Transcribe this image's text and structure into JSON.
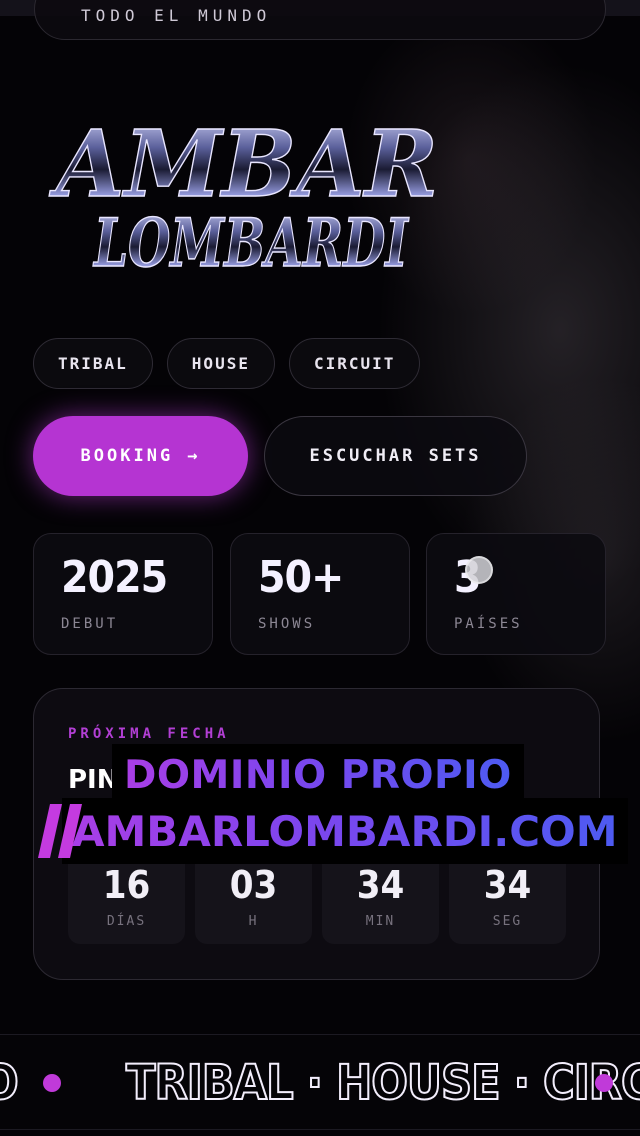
{
  "colors": {
    "accent": "#b534d2",
    "background": "#040306",
    "overlay_gradient_start": "#a93ee6",
    "overlay_gradient_end": "#4d5bf2"
  },
  "top_bar": {
    "text": "TODO EL MUNDO"
  },
  "logo": {
    "line1": "AMBAR",
    "line2": "LOMBARDI"
  },
  "genre_tags": [
    "TRIBAL",
    "HOUSE",
    "CIRCUIT"
  ],
  "cta": {
    "booking_label": "BOOKING",
    "booking_arrow": "→",
    "sets_label": "ESCUCHAR SETS"
  },
  "stats": [
    {
      "value": "2025",
      "label": "DEBUT"
    },
    {
      "value": "50+",
      "label": "SHOWS"
    },
    {
      "value": "3",
      "label": "PAÍSES"
    }
  ],
  "next_event": {
    "kicker": "PRÓXIMA FECHA",
    "name_visible": "PINK",
    "countdown": [
      {
        "value": "16",
        "label": "DÍAS"
      },
      {
        "value": "03",
        "label": "H"
      },
      {
        "value": "34",
        "label": "MIN"
      },
      {
        "value": "34",
        "label": "SEG"
      }
    ]
  },
  "overlay": {
    "line1": "DOMINIO PROPIO",
    "line2": "AMBARLOMBARDI.COM"
  },
  "marquee": {
    "left_fragment": "O",
    "text": "TRIBAL · HOUSE · CIRCUIT"
  },
  "icons": {
    "booking_arrow": "right-arrow-icon",
    "marquee_separator": "dot-icon",
    "overlay_decor": "slash-stripes-icon"
  }
}
